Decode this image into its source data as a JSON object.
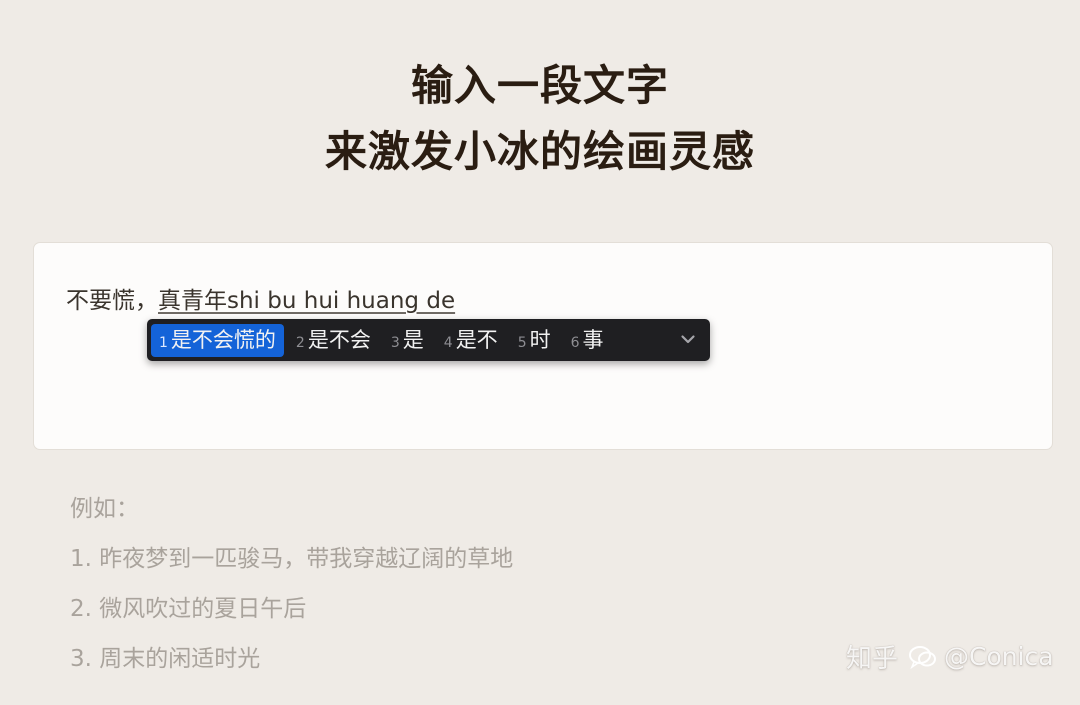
{
  "header": {
    "line1": "输入一段文字",
    "line2": "来激发小冰的绘画灵感"
  },
  "input": {
    "committed_text": "不要慌，",
    "composing_converted": "真青年",
    "composing_pinyin": "shi bu hui huang de"
  },
  "ime": {
    "candidates": [
      {
        "num": "1",
        "text": "是不会慌的",
        "selected": true
      },
      {
        "num": "2",
        "text": "是不会",
        "selected": false
      },
      {
        "num": "3",
        "text": "是",
        "selected": false
      },
      {
        "num": "4",
        "text": "是不",
        "selected": false
      },
      {
        "num": "5",
        "text": "时",
        "selected": false
      },
      {
        "num": "6",
        "text": "事",
        "selected": false
      }
    ],
    "expand_icon": "chevron-down-icon",
    "colors": {
      "background": "#1f1f22",
      "selected": "#1463d8"
    }
  },
  "examples": {
    "title": "例如：",
    "items": [
      "1. 昨夜梦到一匹骏马，带我穿越辽阔的草地",
      "2. 微风吹过的夏日午后",
      "3. 周末的闲适时光"
    ]
  },
  "watermark": {
    "site": "知乎",
    "account": "@Conica"
  },
  "colors": {
    "page_background": "#efebe6",
    "heading": "#2a1d12",
    "example_text": "#a9a39c"
  }
}
